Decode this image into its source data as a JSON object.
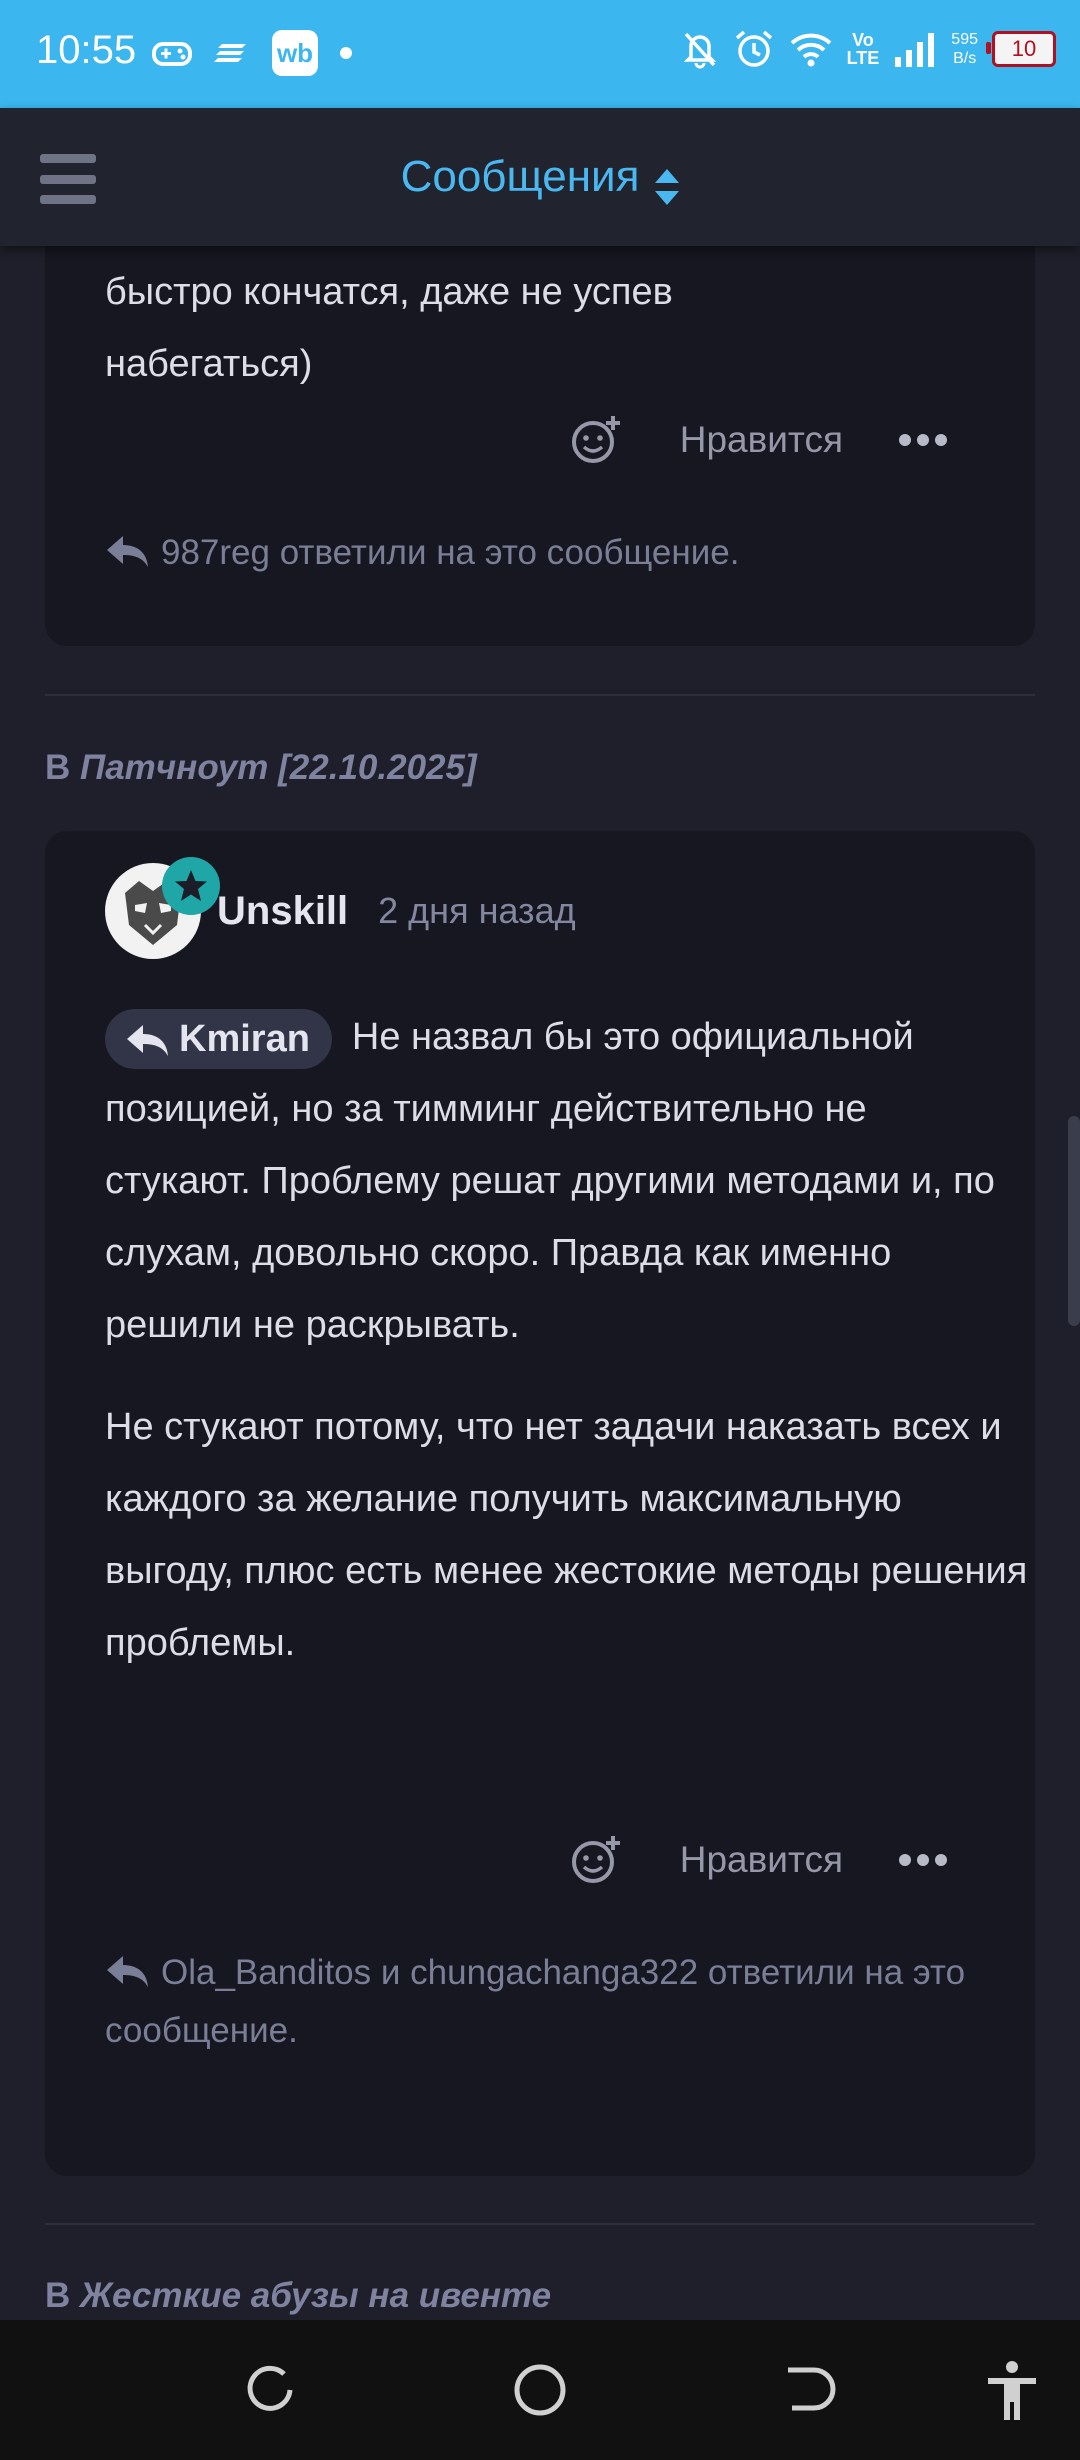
{
  "status_bar": {
    "time": "10:55",
    "left_icons": [
      "gamepad-icon",
      "layers-icon",
      "wb-app-icon",
      "notification-dot"
    ],
    "wb_label": "wb",
    "volte_top": "Vo",
    "volte_bottom": "LTE",
    "speed_value": "595",
    "speed_unit": "B/s",
    "battery_level": "10",
    "right_icons": [
      "bell-off-icon",
      "alarm-icon",
      "wifi-icon",
      "volte-icon",
      "signal-icon",
      "battery-icon"
    ]
  },
  "header": {
    "title": "Сообщения",
    "menu_icon": "hamburger-icon",
    "sort_icon": "sort-icon"
  },
  "posts": [
    {
      "text_partial": "быстро кончатся, даже не успев набегаться)",
      "text_line1": "быстро кончатся, даже не успев",
      "text_line2": "набегаться)",
      "like_label": "Нравится",
      "replied_text": "987reg ответили на это сообщение."
    },
    {
      "thread_prefix": "В",
      "thread_title": "Патчноут [22.10.2025]",
      "author": "Unskill",
      "time": "2 дня назад",
      "quote_author": "Kmiran",
      "paragraph1": "Не назвал бы это официальной позицией, но за тимминг действительно не стукают. Проблему решат другими методами и, по слухам, довольно скоро. Правда как именно решили не раскрывать.",
      "paragraph2": "Не стукают потому, что нет задачи наказать всех и каждого за желание получить максимальную выгоду, плюс есть менее жестокие методы решения проблемы.",
      "like_label": "Нравится",
      "replied_text": "Ola_Banditos и chungachanga322 ответили на это сообщение."
    }
  ],
  "next_thread": {
    "prefix": "В",
    "title": "Жесткие абузы на ивенте"
  },
  "nav_bar": {
    "buttons": [
      "recents-icon",
      "home-icon",
      "back-icon",
      "accessibility-icon"
    ]
  },
  "colors": {
    "status_bar": "#3cb6ef",
    "accent": "#4ab8f0",
    "background": "#1e1f2a",
    "card": "#161720",
    "badge": "#1fa6a6"
  }
}
